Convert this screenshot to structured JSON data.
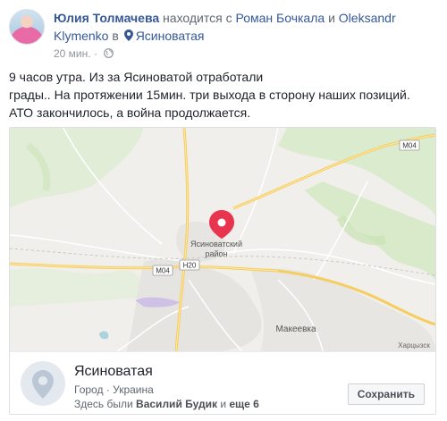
{
  "post": {
    "author": "Юлия Толмачева",
    "with_text": " находится с ",
    "tagged_1": "Роман Бочкала",
    "and_text": " и ",
    "tagged_2": "Oleksandr Klymenko",
    "in_text": " в ",
    "location": "Ясиноватая",
    "time": "20 мин.",
    "time_dot": " · ",
    "lines": [
      "9 часов утра. Из за Ясиноватой отработали",
      "грады.. На протяжении 15мин. три выхода в сторону наших позиций.",
      "АТО закончилось, а война продолжается."
    ]
  },
  "map": {
    "labels": {
      "district_1": "Ясиноватский",
      "district_2": "район",
      "city": "Макеевка",
      "kharcyzsk": "Харцызск",
      "road_h20": "H20",
      "road_m04_left": "M04",
      "road_m04_right": "M04"
    },
    "colors": {
      "pin": "#e8344e",
      "road": "#f7d46b",
      "land": "#f2f0ec",
      "green": "#d4ebc4"
    }
  },
  "place": {
    "title": "Ясиноватая",
    "subtitle": "Город · Украина",
    "visited_prefix": "Здесь были ",
    "visited_name": "Василий Будик",
    "visited_and": " и ",
    "visited_more": "еще 6",
    "save_label": "Сохранить"
  }
}
